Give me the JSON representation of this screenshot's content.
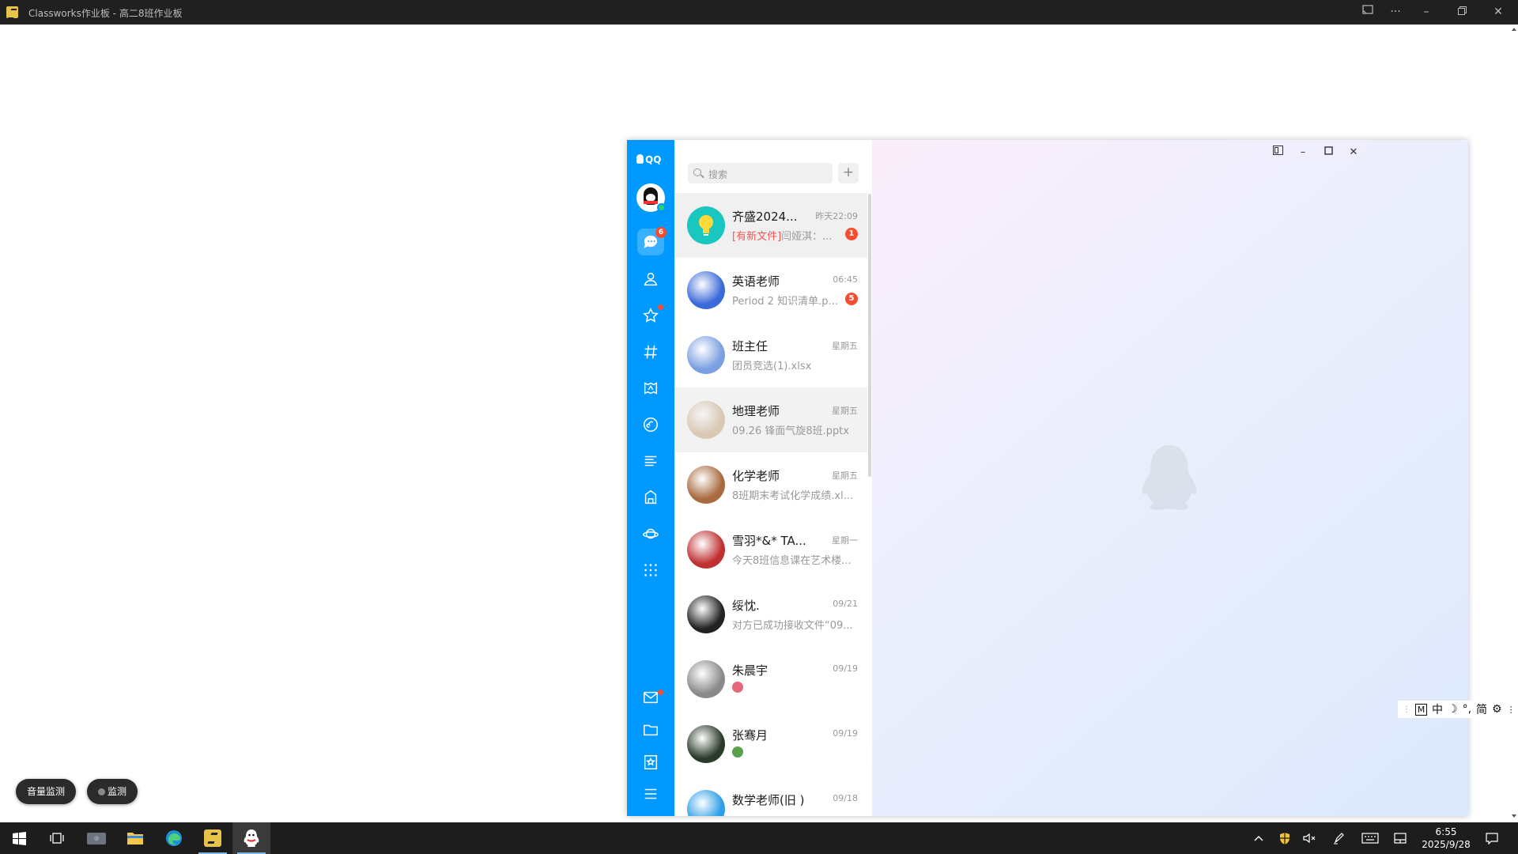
{
  "host": {
    "title": "Classworks作业板 - 高二8班作业板",
    "buttons": [
      "cast",
      "more",
      "minimize",
      "restore",
      "close"
    ]
  },
  "qq": {
    "logo": "QQ",
    "search_placeholder": "搜索",
    "add_label": "+",
    "nav_badge": "6",
    "conversations": [
      {
        "name": "齐盛2024...",
        "time": "昨天22:09",
        "tag": "[有新文件]",
        "msg": "闫娅淇：...",
        "badge": "1",
        "avatar_color": "#19c6c0"
      },
      {
        "name": "英语老师",
        "time": "06:45",
        "tag": "",
        "msg": "Period 2 知识清单.p...",
        "badge": "5",
        "avatar_color": "#3a6ad8"
      },
      {
        "name": "班主任",
        "time": "星期五",
        "tag": "",
        "msg": "团员竞选(1).xlsx",
        "badge": "",
        "avatar_color": "#7b9fe0"
      },
      {
        "name": "地理老师",
        "time": "星期五",
        "tag": "",
        "msg": "09.26 锋面气旋8班.pptx",
        "badge": "",
        "avatar_color": "#d9c8b4"
      },
      {
        "name": "化学老师",
        "time": "星期五",
        "tag": "",
        "msg": "8班期末考试化学成绩.xl...",
        "badge": "",
        "avatar_color": "#a86a3f"
      },
      {
        "name": "雪羽*&* TA...",
        "time": "星期一",
        "tag": "",
        "msg": "今天8班信息课在艺术楼...",
        "badge": "",
        "avatar_color": "#c03030"
      },
      {
        "name": "绥忱.",
        "time": "09/21",
        "tag": "",
        "msg": "对方已成功接收文件“09...",
        "badge": "",
        "avatar_color": "#222222"
      },
      {
        "name": "朱晨宇",
        "time": "09/19",
        "tag": "",
        "msg": "",
        "badge": "",
        "avatar_color": "#8a8a8a"
      },
      {
        "name": "张骞月",
        "time": "09/19",
        "tag": "",
        "msg": "",
        "badge": "",
        "avatar_color": "#2a3a2a"
      },
      {
        "name": "数学老师(旧 )",
        "time": "09/18",
        "tag": "",
        "msg": "",
        "badge": "",
        "avatar_color": "#2a9ee6"
      }
    ]
  },
  "pills": {
    "volume": "音量监测",
    "monitor": "监测"
  },
  "ime": {
    "mode": "M",
    "lang": "中",
    "simp": "简"
  },
  "clock": {
    "time": "6:55",
    "date": "2025/9/28"
  },
  "colors": {
    "qq_blue": "#0099ff",
    "badge_red": "#f74c30",
    "tag_red": "#f25656"
  }
}
